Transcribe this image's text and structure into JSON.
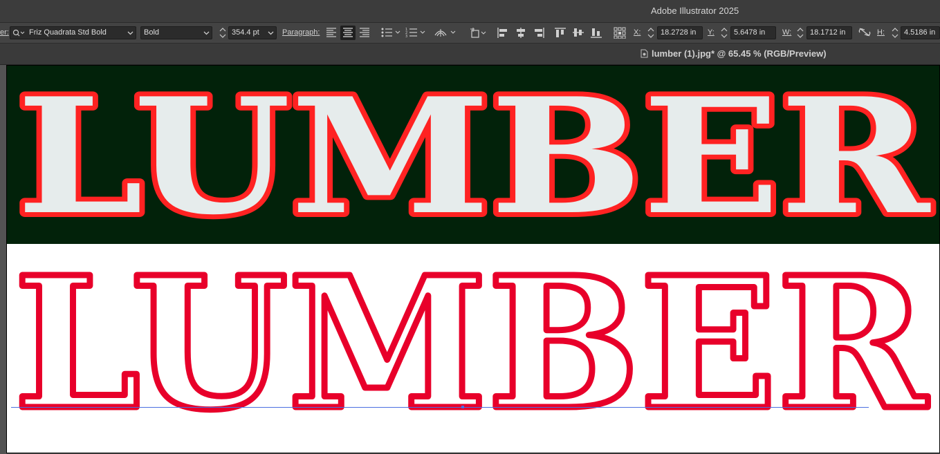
{
  "app": {
    "title": "Adobe Illustrator 2025"
  },
  "control_bar": {
    "character_label_fragment": "er:",
    "font_family": "Friz Quadrata Std Bold",
    "font_style": "Bold",
    "font_size": "354.4 pt",
    "paragraph_label": "Paragraph:",
    "x_label": "X:",
    "x_value": "18.2728 in",
    "y_label": "Y:",
    "y_value": "5.6478 in",
    "w_label": "W:",
    "w_value": "18.1712 in",
    "h_label": "H:",
    "h_value": "4.5186 in"
  },
  "document_tab": {
    "title": "lumber (1).jpg* @ 65.45 % (RGB/Preview)"
  },
  "artwork": {
    "photo_text": "LUMBER",
    "vector_text": "LUMBER",
    "colors": {
      "photo_background": "#02220a",
      "photo_fill": "#e6ecec",
      "photo_stroke": "#ff2222",
      "vector_fill": "#ffffff",
      "vector_stroke": "#e8002a",
      "selection": "#4a6fe0"
    }
  }
}
